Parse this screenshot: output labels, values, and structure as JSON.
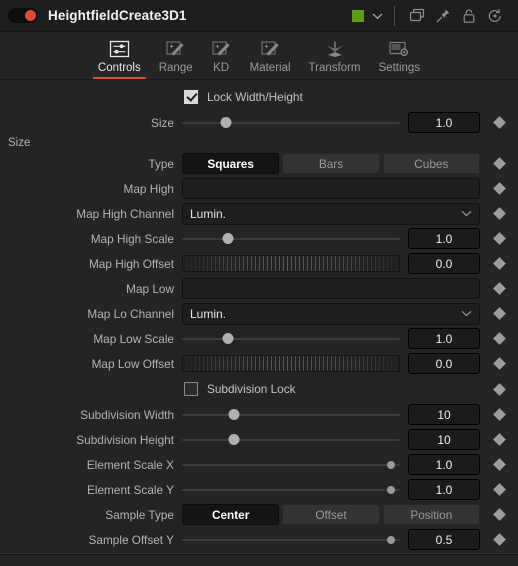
{
  "titlebar": {
    "node_name": "HeightfieldCreate3D1",
    "enable_toggle": {
      "name": "node-enable-toggle",
      "state": "on",
      "dot_color": "#e0483a"
    },
    "color_chip": {
      "name": "node-color-chip",
      "color": "#5f9e12"
    },
    "icons": [
      {
        "name": "color-dropdown-chevron-icon",
        "glyph": "chevron-down"
      },
      {
        "name": "duplicate-window-icon",
        "glyph": "copy"
      },
      {
        "name": "pin-icon",
        "glyph": "pin"
      },
      {
        "name": "lock-icon",
        "glyph": "lock-open"
      },
      {
        "name": "reset-history-icon",
        "glyph": "undo-clock"
      }
    ]
  },
  "tabs": [
    {
      "label": "Controls",
      "icon": "sliders-icon",
      "active": true
    },
    {
      "label": "Range",
      "icon": "magic-wand-icon",
      "active": false
    },
    {
      "label": "KD",
      "icon": "magic-wand-icon",
      "active": false
    },
    {
      "label": "Material",
      "icon": "magic-wand-icon",
      "active": false
    },
    {
      "label": "Transform",
      "icon": "axis-3d-icon",
      "active": false
    },
    {
      "label": "Settings",
      "icon": "gear-screen-icon",
      "active": false
    }
  ],
  "accent_color": "#d8503a",
  "controls": {
    "lock_width_height": {
      "label": "Lock Width/Height",
      "checked": true
    },
    "size": {
      "label": "Size",
      "sublabel": "Size",
      "value": "1.0",
      "slider_pct": 20
    },
    "type": {
      "label": "Type",
      "options": [
        "Squares",
        "Bars",
        "Cubes"
      ],
      "selected": "Squares"
    },
    "map_high": {
      "label": "Map High",
      "value": ""
    },
    "map_high_channel": {
      "label": "Map High Channel",
      "value": "Lumin."
    },
    "map_high_scale": {
      "label": "Map High Scale",
      "value": "1.0",
      "slider_pct": 21
    },
    "map_high_offset": {
      "label": "Map High Offset",
      "value": "0.0"
    },
    "map_low": {
      "label": "Map Low",
      "value": ""
    },
    "map_lo_channel": {
      "label": "Map Lo Channel",
      "value": "Lumin."
    },
    "map_low_scale": {
      "label": "Map Low Scale",
      "value": "1.0",
      "slider_pct": 21
    },
    "map_low_offset": {
      "label": "Map Low Offset",
      "value": "0.0"
    },
    "subdivision_lock": {
      "label": "Subdivision Lock",
      "checked": false
    },
    "subdivision_width": {
      "label": "Subdivision Width",
      "value": "10",
      "slider_pct": 24
    },
    "subdivision_height": {
      "label": "Subdivision Height",
      "value": "10",
      "slider_pct": 24
    },
    "element_scale_x": {
      "label": "Element Scale X",
      "value": "1.0",
      "slider_pct": 96
    },
    "element_scale_y": {
      "label": "Element Scale Y",
      "value": "1.0",
      "slider_pct": 96
    },
    "sample_type": {
      "label": "Sample Type",
      "options": [
        "Center",
        "Offset",
        "Position"
      ],
      "selected": "Center"
    },
    "sample_offset_y": {
      "label": "Sample Offset Y",
      "value": "0.5",
      "slider_pct": 96
    }
  }
}
